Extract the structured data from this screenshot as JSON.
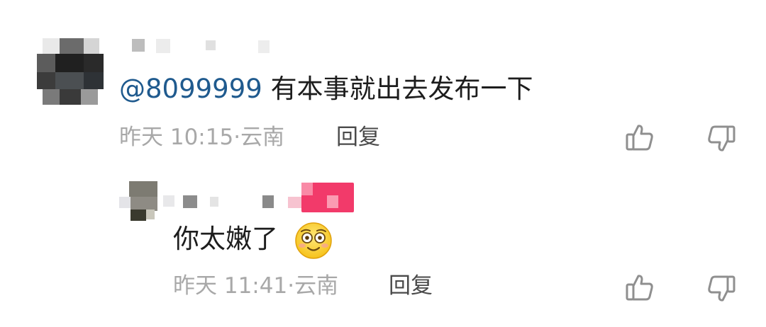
{
  "comments": [
    {
      "mention": "@8099999",
      "text": "有本事就出去发布一下",
      "time": "昨天 10:15",
      "separator": "·",
      "location": "云南",
      "reply_label": "回复",
      "like_icon": "thumb-up-icon",
      "dislike_icon": "thumb-down-icon"
    },
    {
      "text": "你太嫩了",
      "emoji_icon": "smiling-face-emoji-icon",
      "time": "昨天 11:41",
      "separator": "·",
      "location": "云南",
      "reply_label": "回复",
      "like_icon": "thumb-up-icon",
      "dislike_icon": "thumb-down-icon"
    }
  ],
  "colors": {
    "mention": "#1f5a8e",
    "meta": "#a8a8a8",
    "reply": "#4a4a4a",
    "pink_badge": "#f23a6a"
  }
}
